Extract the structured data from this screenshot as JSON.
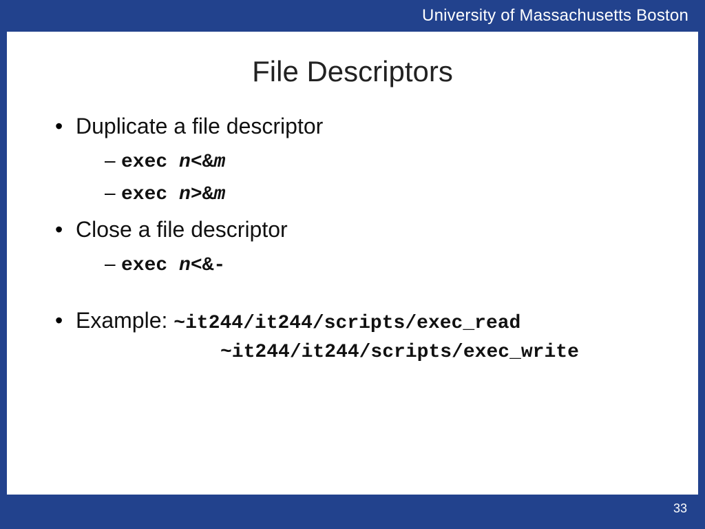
{
  "header": {
    "org": "University of Massachusetts Boston"
  },
  "title": "File Descriptors",
  "bullets": {
    "b1": {
      "text": "Duplicate a file descriptor"
    },
    "b1s1": {
      "cmd": "exec ",
      "var1": "n",
      "op": "<&",
      "var2": "m"
    },
    "b1s2": {
      "cmd": "exec ",
      "var1": "n",
      "op": ">&",
      "var2": "m"
    },
    "b2": {
      "text": "Close a file descriptor"
    },
    "b2s1": {
      "cmd": "exec ",
      "var1": "n",
      "op": "<&-"
    },
    "b3": {
      "label": "Example: ",
      "path1": "~it244/it244/scripts/exec_read",
      "path2": "~it244/it244/scripts/exec_write"
    }
  },
  "footer": {
    "page": "33"
  }
}
